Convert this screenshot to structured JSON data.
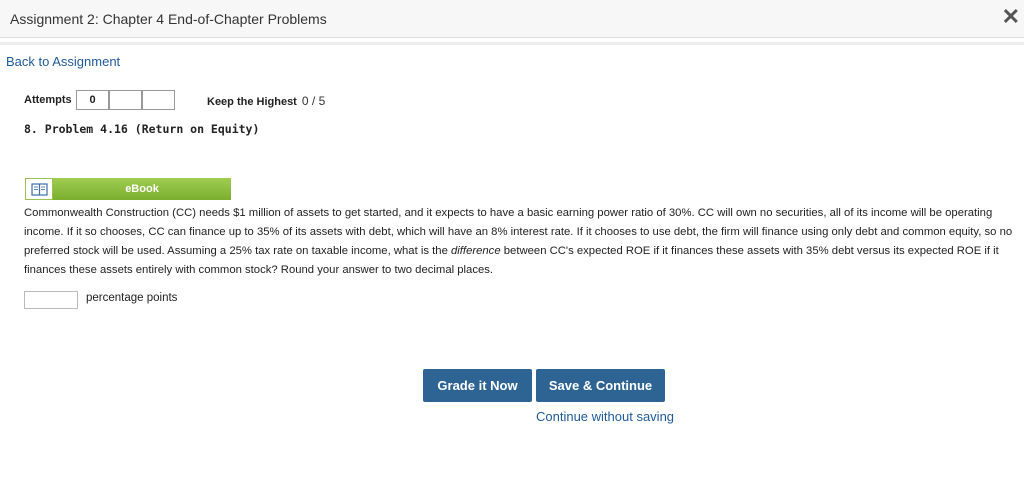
{
  "window": {
    "title": "Assignment 2: Chapter 4 End-of-Chapter Problems",
    "close_glyph": "✕"
  },
  "nav": {
    "back_label": "Back to Assignment"
  },
  "attempts": {
    "label": "Attempts",
    "values": [
      "0",
      "",
      ""
    ]
  },
  "scoring": {
    "label": "Keep the Highest",
    "score": "0 / 5"
  },
  "problem": {
    "title": "8.  Problem 4.16 (Return on Equity)",
    "ebook_label": "eBook",
    "question_part1": "Commonwealth Construction (CC) needs $1 million of assets to get started, and it expects to have a basic earning power ratio of 30%. CC will own no securities, all of its income will be operating income. If it so chooses, CC can finance up to 35% of its assets with debt, which will have an 8% interest rate. If it chooses to use debt, the firm will finance using only debt and common equity, so no preferred stock will be used. Assuming a 25% tax rate on taxable income, what is the ",
    "question_emphasis": "difference",
    "question_part2": " between CC's expected ROE if it finances these assets with 35% debt versus its expected ROE if it finances these assets entirely with common stock? Round your answer to two decimal places.",
    "answer_value": "",
    "answer_unit": "percentage points"
  },
  "actions": {
    "grade_label": "Grade it Now",
    "save_label": "Save & Continue",
    "continue_label": "Continue without saving"
  },
  "colors": {
    "button": "#2e6494",
    "link": "#1f5a99",
    "ebook_green": "#8cbf3f"
  }
}
